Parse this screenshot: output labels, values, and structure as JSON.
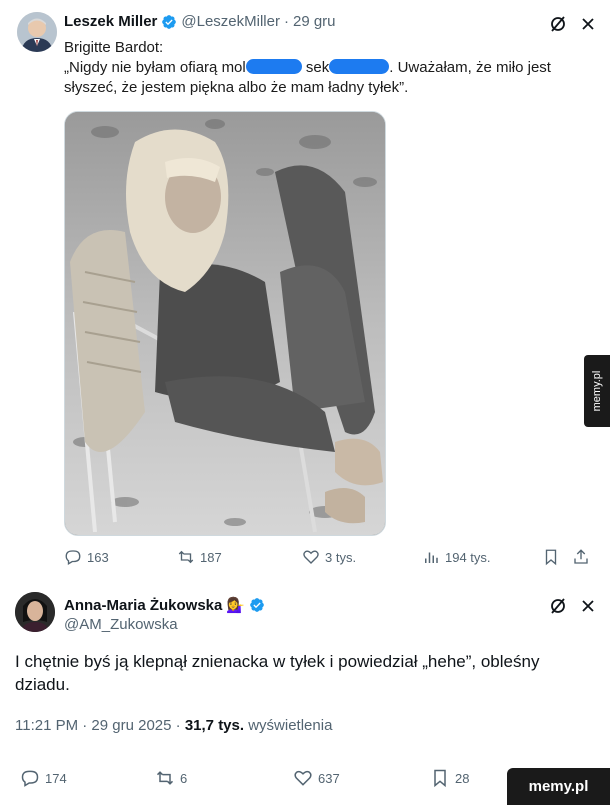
{
  "tweet1": {
    "name": "Leszek Miller",
    "handle": "@LeszekMiller",
    "separator": "·",
    "date": "29 gru",
    "text_line1": "Brigitte Bardot:",
    "text_a": "„Nigdy nie byłam ofiarą mol",
    "text_b": "sek",
    "text_c": ". Uważałam, że miło jest słyszeć, że jestem piękna albo że mam ładny tyłek”.",
    "actions": {
      "replies": "163",
      "reposts": "187",
      "likes": "3 tys.",
      "views": "194 tys."
    }
  },
  "tweet2": {
    "name": "Anna-Maria Żukowska",
    "emoji": "💁‍♀️",
    "handle": "@AM_Zukowska",
    "text": "I chętnie byś ją klepnął znienacka w tyłek i powiedział „hehe”, obleśny dziadu.",
    "time": "11:21 PM · 29 gru 2025 · ",
    "views_count": "31,7 tys.",
    "views_label": " wyświetlenia",
    "actions": {
      "replies": "174",
      "reposts": "6",
      "likes": "637",
      "bookmarks": "28"
    }
  },
  "watermark": {
    "side": "memy.pl",
    "bottom": "memy.pl"
  },
  "colors": {
    "verified": "#1d9bf0",
    "secondary_text": "#536471",
    "redaction": "#1d7bf0"
  }
}
